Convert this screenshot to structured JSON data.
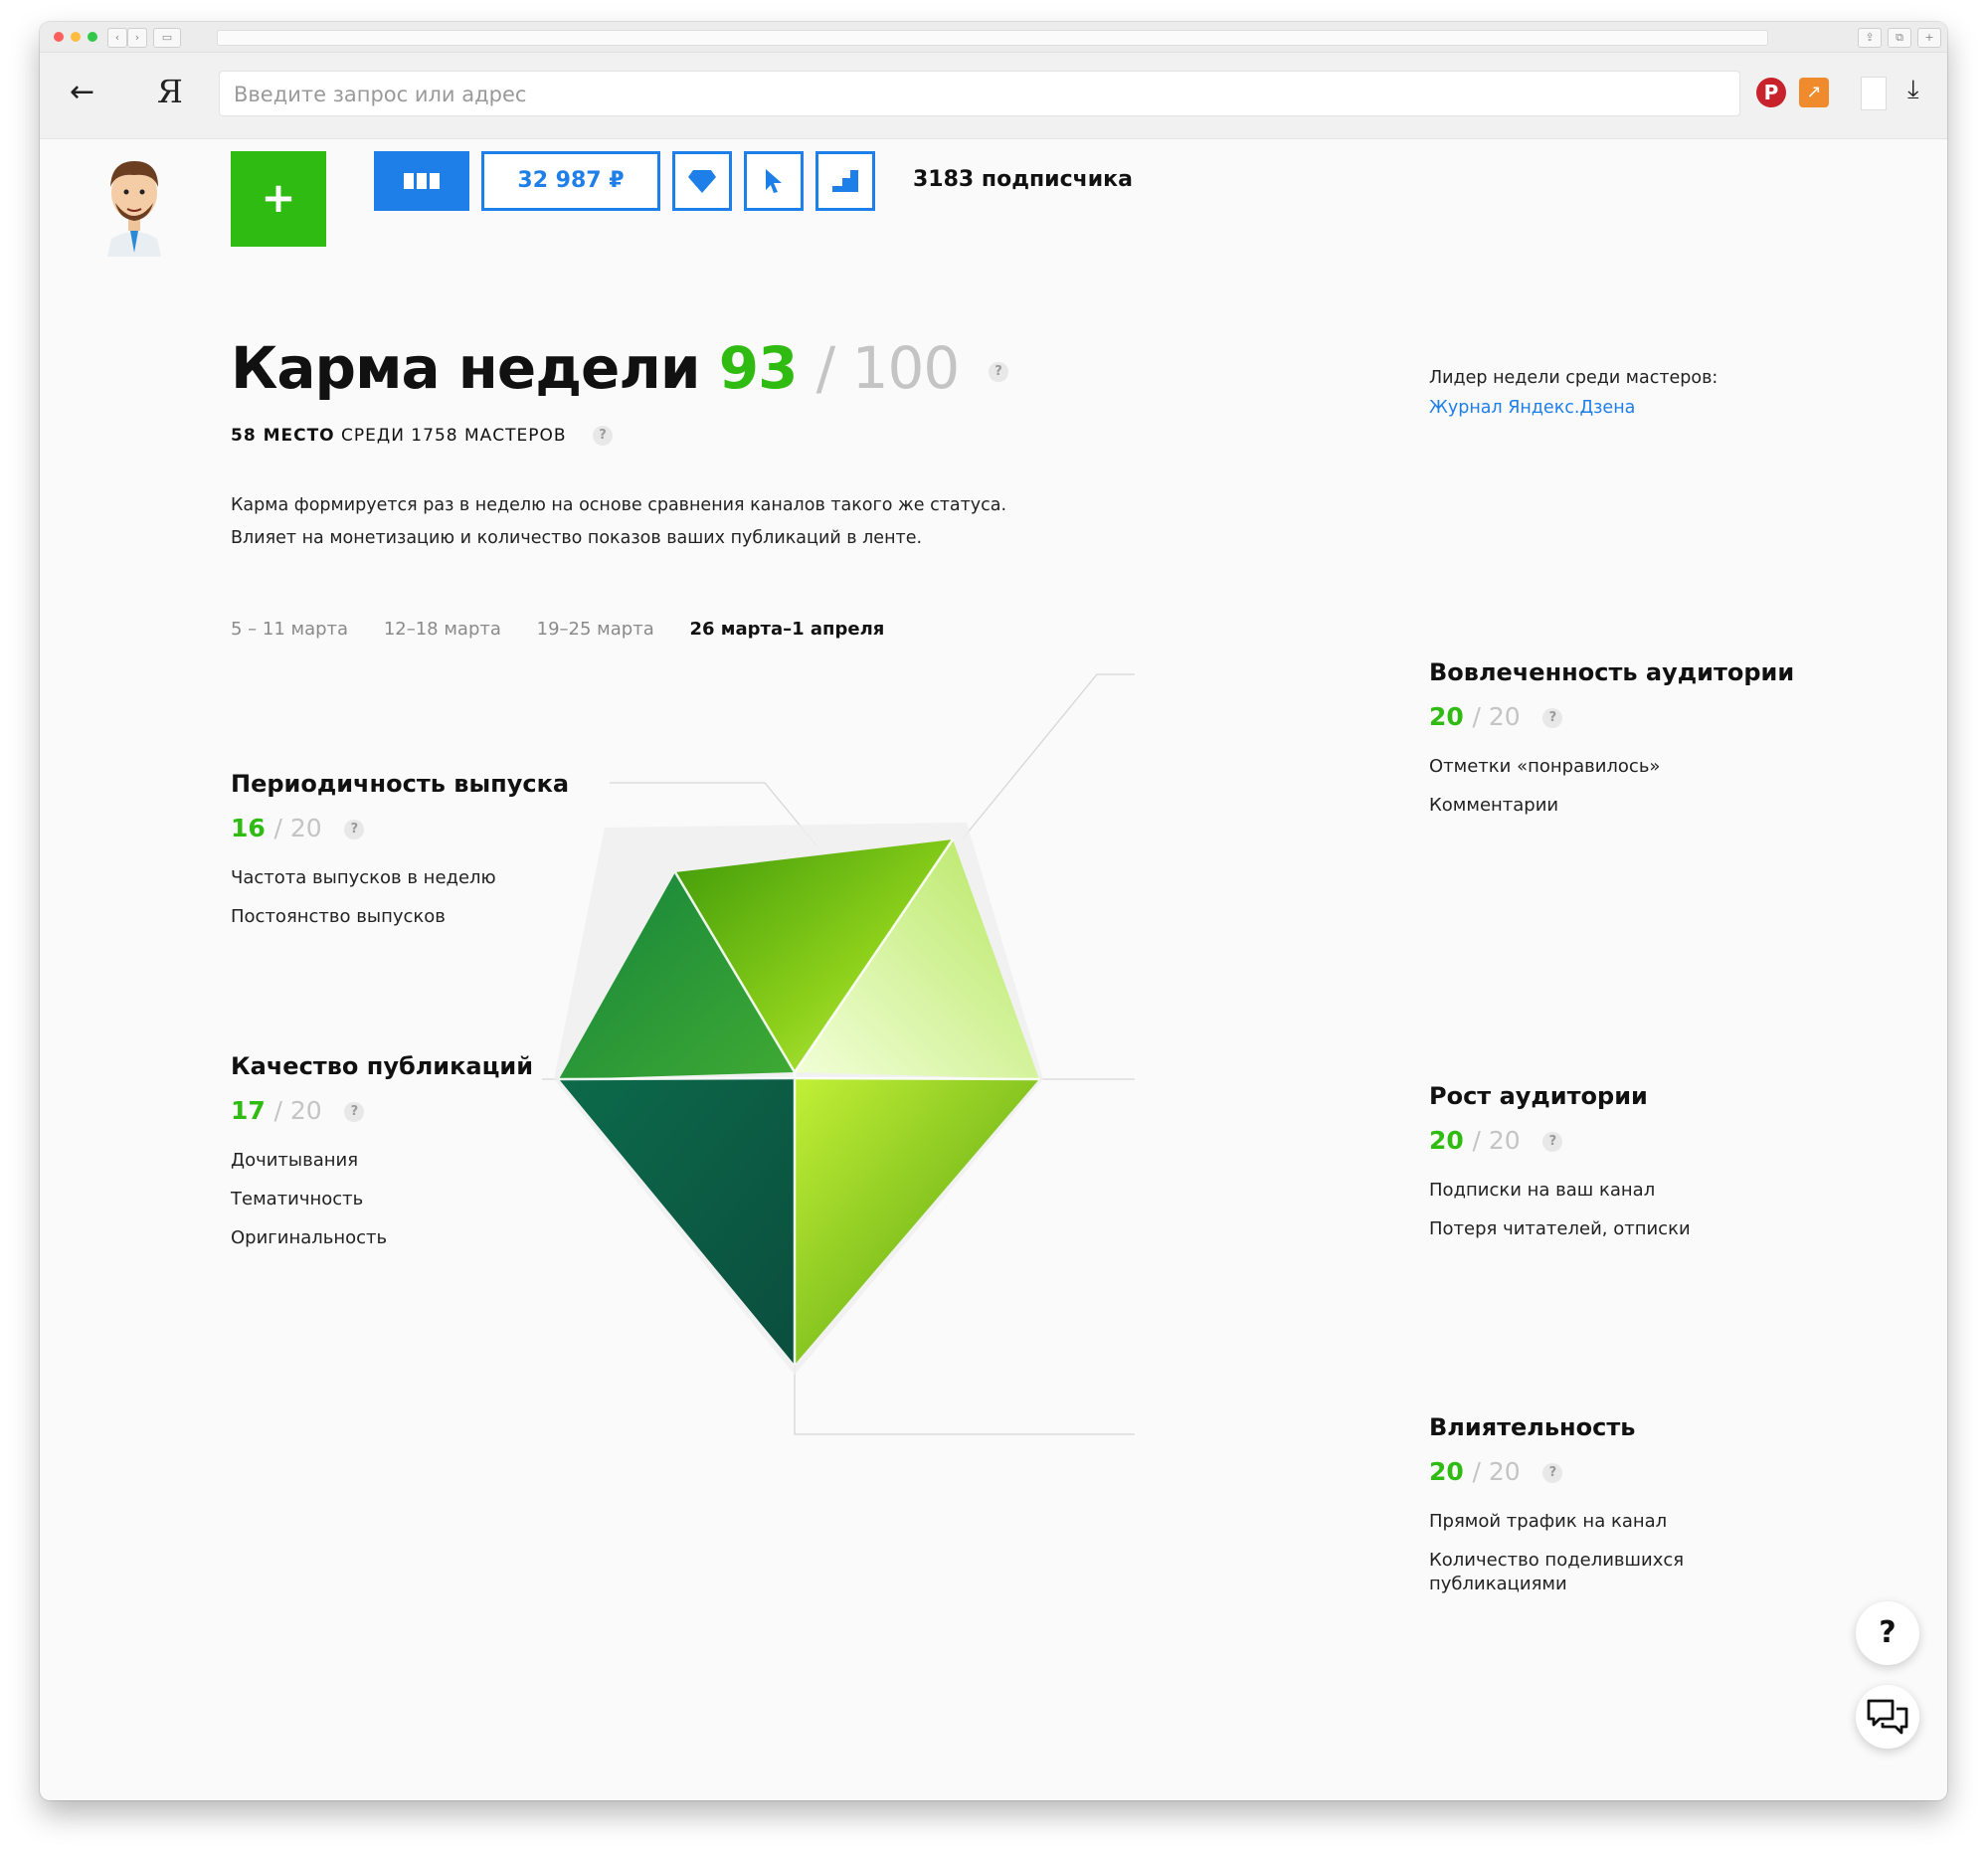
{
  "browser": {
    "address_placeholder": "Введите запрос или адрес",
    "logo": "Я",
    "back_icon": "arrow-left-icon",
    "extensions": [
      "pinterest-icon",
      "stats-icon",
      "page-icon",
      "download-icon"
    ]
  },
  "header": {
    "add_label": "+",
    "balance": "32 987 ₽",
    "subscribers": "3183 подписчика",
    "icons": [
      "grid-icon",
      "diamond-icon",
      "cursor-icon",
      "stairs-icon"
    ]
  },
  "karma": {
    "title": "Карма недели",
    "score": "93",
    "max": "/ 100",
    "rank_strong": "58 МЕСТО",
    "rank_rest": " СРЕДИ 1758 МАСТЕРОВ",
    "description_1": "Карма формируется раз в неделю на основе сравнения каналов такого же статуса.",
    "description_2": "Влияет на монетизацию и количество показов ваших публикаций в ленте.",
    "help": "?"
  },
  "leader": {
    "label": "Лидер недели среди мастеров:",
    "link": "Журнал Яндекс.Дзена"
  },
  "weeks": [
    {
      "label": "5 – 11 марта",
      "active": false
    },
    {
      "label": "12–18 марта",
      "active": false
    },
    {
      "label": "19–25 марта",
      "active": false
    },
    {
      "label": "26 марта–1 апреля",
      "active": true
    }
  ],
  "metrics": {
    "periodicity": {
      "title": "Периодичность выпуска",
      "score": "16",
      "max": "/ 20",
      "items": [
        "Частота выпусков в неделю",
        "Постоянство выпусков"
      ]
    },
    "quality": {
      "title": "Качество публикаций",
      "score": "17",
      "max": "/ 20",
      "items": [
        "Дочитывания",
        "Тематичность",
        "Оригинальность"
      ]
    },
    "engagement": {
      "title": "Вовлеченность аудитории",
      "score": "20",
      "max": "/ 20",
      "items": [
        "Отметки «понравилось»",
        "Комментарии"
      ]
    },
    "growth": {
      "title": "Рост аудитории",
      "score": "20",
      "max": "/ 20",
      "items": [
        "Подписки на ваш канал",
        "Потеря читателей, отписки"
      ]
    },
    "influence": {
      "title": "Влиятельность",
      "score": "20",
      "max": "/ 20",
      "items": [
        "Прямой трафик на канал",
        "Количество поделившихся публикациями"
      ]
    }
  },
  "fabs": {
    "help": "?",
    "chat_icon": "chat-icon"
  },
  "colors": {
    "accent_green": "#2fbb12",
    "accent_blue": "#1f7fe8",
    "muted": "#c4c4c4"
  }
}
